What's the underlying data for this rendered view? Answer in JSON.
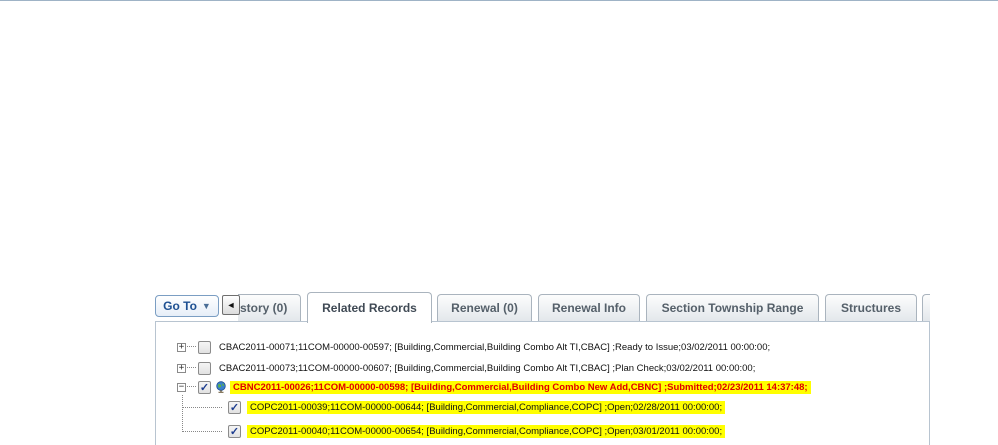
{
  "toolbar": {
    "goto_label": "Go To",
    "goto_caret": "▼",
    "scroll_left": "◄"
  },
  "tabs": [
    {
      "label": "story (0)"
    },
    {
      "label": "Related Records"
    },
    {
      "label": "Renewal (0)"
    },
    {
      "label": "Renewal Info"
    },
    {
      "label": "Section Township Range"
    },
    {
      "label": "Structures"
    }
  ],
  "tree": {
    "rows": [
      {
        "expander": "+",
        "checked": false,
        "text": "CBAC2011-00071;11COM-00000-00597; [Building,Commercial,Building Combo Alt TI,CBAC] ;Ready to Issue;03/02/2011 00:00:00;"
      },
      {
        "expander": "+",
        "checked": false,
        "text": "CBAC2011-00073;11COM-00000-00607; [Building,Commercial,Building Combo Alt TI,CBAC] ;Plan Check;03/02/2011 00:00:00;"
      },
      {
        "expander": "−",
        "checked": true,
        "text": "CBNC2011-00026;11COM-00000-00598; [Building,Commercial,Building Combo New Add,CBNC] ;Submitted;02/23/2011 14:37:48;"
      },
      {
        "checked": true,
        "text": "COPC2011-00039;11COM-00000-00644; [Building,Commercial,Compliance,COPC] ;Open;02/28/2011 00:00:00;"
      },
      {
        "checked": true,
        "text": "COPC2011-00040;11COM-00000-00654; [Building,Commercial,Compliance,COPC] ;Open;03/01/2011 00:00:00;"
      }
    ],
    "checkmark": "✓",
    "highlight_color": "#ffff00",
    "current_record_color": "#e00000"
  }
}
